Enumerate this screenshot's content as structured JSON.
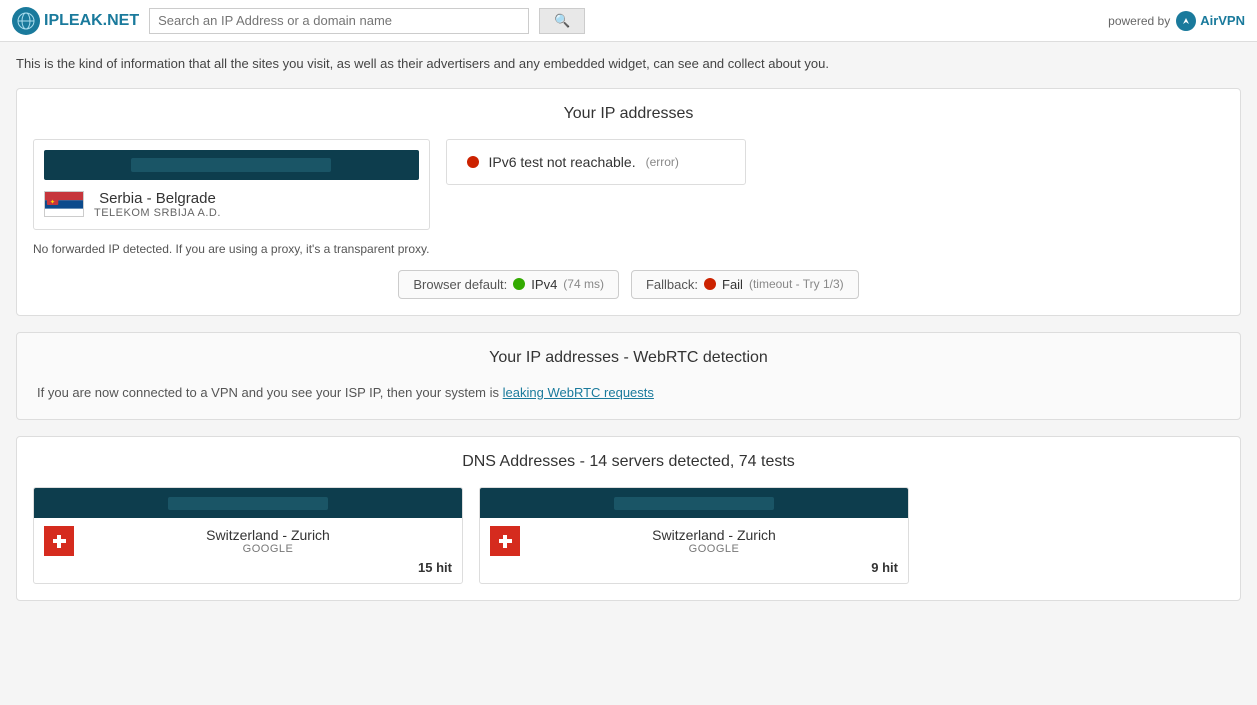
{
  "header": {
    "logo_text": "IPLEAK.NET",
    "search_placeholder": "Search an IP Address or a domain name",
    "search_button_label": "",
    "powered_by_text": "powered by",
    "airvpn_label": "AirVPN"
  },
  "intro": {
    "text": "This is the kind of information that all the sites you visit, as well as their advertisers and any embedded widget, can see and collect about you."
  },
  "ip_section": {
    "title": "Your IP addresses",
    "main_card": {
      "country": "Serbia - Belgrade",
      "isp": "TELEKOM SRBIJA a.d."
    },
    "ipv6_card": {
      "text": "IPv6 test not reachable.",
      "note": "(error)"
    },
    "no_forwarded": "No forwarded IP detected. If you are using a proxy, it's a transparent proxy.",
    "browser_default": {
      "label": "Browser default:",
      "protocol": "IPv4",
      "speed": "(74 ms)"
    },
    "fallback": {
      "label": "Fallback:",
      "status": "Fail",
      "note": "(timeout - Try 1/3)"
    }
  },
  "webrtc_section": {
    "title": "Your IP addresses - WebRTC detection",
    "text": "If you are now connected to a VPN and you see your ISP IP, then your system is",
    "link_text": "leaking WebRTC requests"
  },
  "dns_section": {
    "title": "DNS Addresses - 14 servers detected, 74 tests",
    "cards": [
      {
        "country": "Switzerland - Zurich",
        "isp": "GOOGLE",
        "hits": "15 hit"
      },
      {
        "country": "Switzerland - Zurich",
        "isp": "GOOGLE",
        "hits": "9 hit"
      }
    ]
  }
}
